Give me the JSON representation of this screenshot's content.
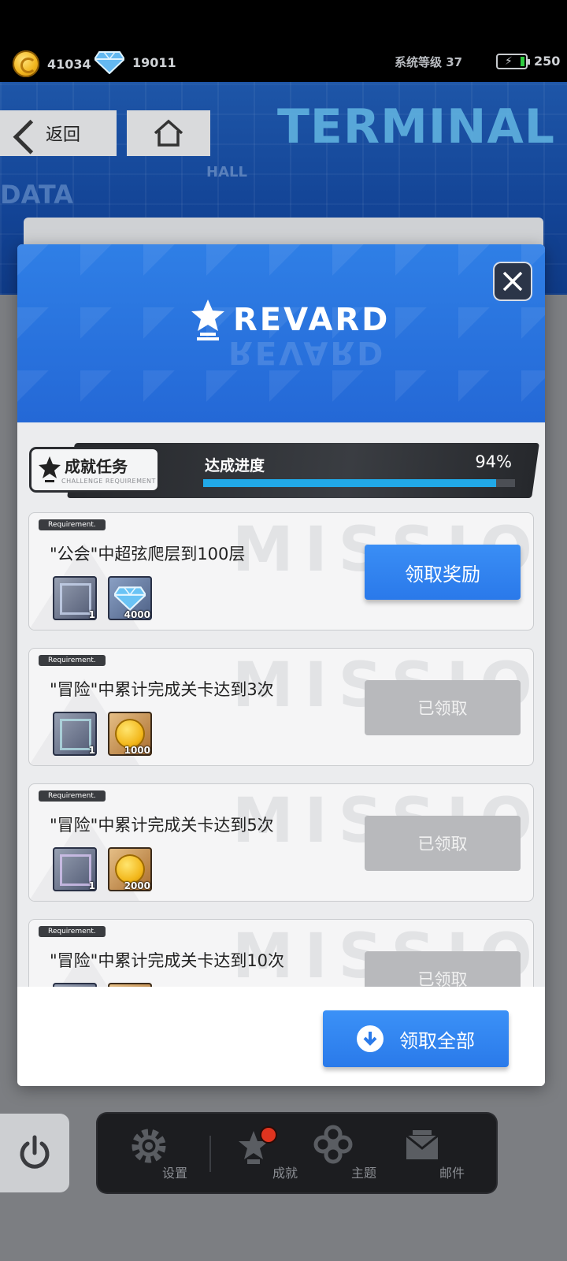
{
  "status": {
    "coins": "41034",
    "gems": "19011",
    "system_level": "系统等级 37",
    "energy": "250"
  },
  "header": {
    "back_label": "返回",
    "bg_word": "TERMINAL",
    "bg_word_2": "DATA",
    "bg_word_3": "HALL"
  },
  "modal": {
    "title": "REVARD",
    "progress": {
      "badge_title": "成就任务",
      "badge_subtitle": "CHALLENGE REQUIREMENT",
      "label": "达成进度",
      "percent_text": "94%",
      "percent_value": 94
    },
    "watermark": "MISSIO",
    "missions": [
      {
        "tag": "Requirement.",
        "title": "\"公会\"中超弦爬层到100层",
        "items": [
          {
            "type": "frame",
            "qty": "1"
          },
          {
            "type": "gem",
            "qty": "4000"
          }
        ],
        "button": "领取奖励",
        "state": "claimable"
      },
      {
        "tag": "Requirement.",
        "title": "\"冒险\"中累计完成关卡达到3次",
        "items": [
          {
            "type": "frame",
            "qty": "1"
          },
          {
            "type": "coin",
            "qty": "1000"
          }
        ],
        "button": "已领取",
        "state": "claimed"
      },
      {
        "tag": "Requirement.",
        "title": "\"冒险\"中累计完成关卡达到5次",
        "items": [
          {
            "type": "frame",
            "qty": "1"
          },
          {
            "type": "coin",
            "qty": "2000"
          }
        ],
        "button": "已领取",
        "state": "claimed"
      },
      {
        "tag": "Requirement.",
        "title": "\"冒险\"中累计完成关卡达到10次",
        "items": [
          {
            "type": "frame",
            "qty": ""
          },
          {
            "type": "coin",
            "qty": ""
          }
        ],
        "button": "已领取",
        "state": "claimed"
      }
    ],
    "claim_all_label": "领取全部"
  },
  "nav": {
    "settings": "设置",
    "achievements": "成就",
    "theme": "主题",
    "mail": "邮件"
  },
  "colors": {
    "accent_blue": "#2f7fe6",
    "progress_fill": "#21a9e8",
    "claimed_gray": "#b8b9bc",
    "notify_red": "#e0341f"
  }
}
